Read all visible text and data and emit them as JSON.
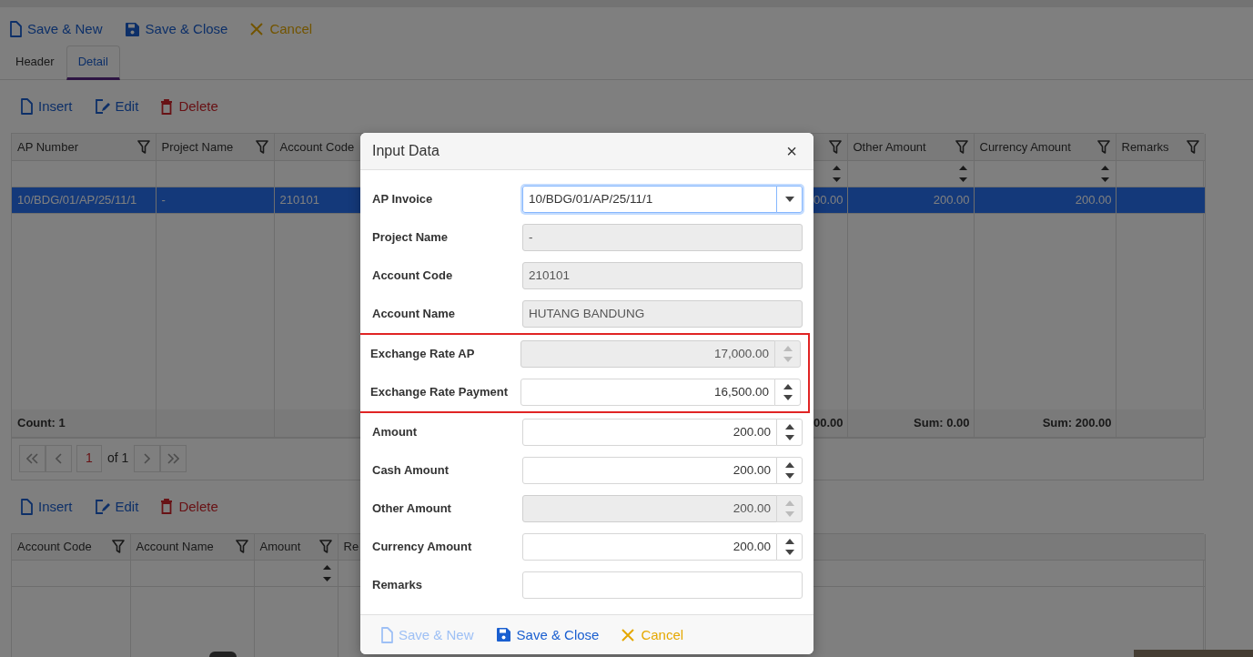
{
  "toolbar": [
    {
      "label": "Save & New",
      "kind": "new"
    },
    {
      "label": "Save & Close",
      "kind": "save"
    },
    {
      "label": "Cancel",
      "kind": "cancel"
    }
  ],
  "tabs": [
    {
      "label": "Header",
      "selected": false
    },
    {
      "label": "Detail",
      "selected": true
    }
  ],
  "detail_toolbar": [
    {
      "label": "Insert",
      "kind": "insert"
    },
    {
      "label": "Edit",
      "kind": "edit"
    },
    {
      "label": "Delete",
      "kind": "delete"
    }
  ],
  "detail_grid": {
    "columns": [
      {
        "label": "AP Number",
        "filter": true,
        "numeric": false
      },
      {
        "label": "Project Name",
        "filter": true,
        "numeric": false
      },
      {
        "label": "Account Code"
      },
      {
        "filter": true,
        "numeric": true
      },
      {
        "label": "Other Amount",
        "filter": true,
        "numeric": true
      },
      {
        "label": "Currency Amount",
        "filter": true,
        "numeric": true
      },
      {
        "label": "Remarks",
        "filter": true,
        "numeric": false
      }
    ],
    "rows": [
      {
        "selected": true,
        "cells": [
          "10/BDG/01/AP/25/11/1",
          "-",
          "210101",
          "00.00",
          "200.00",
          "200.00"
        ]
      }
    ],
    "footer": {
      "cells": [
        "Count: 1",
        null,
        null,
        "00.00",
        "Sum: 0.00",
        "Sum: 200.00"
      ]
    },
    "pager": {
      "page": "1",
      "total": "of 1"
    }
  },
  "account_toolbar": [
    {
      "label": "Insert",
      "kind": "insert"
    },
    {
      "label": "Edit",
      "kind": "edit"
    },
    {
      "label": "Delete",
      "kind": "delete"
    }
  ],
  "account_grid": {
    "columns": [
      {
        "label": "Account Code",
        "filter": true,
        "numeric": false
      },
      {
        "label": "Account Name",
        "filter": true,
        "numeric": false
      },
      {
        "label": "Amount",
        "filter": true,
        "numeric": true
      },
      {
        "label": "Re",
        "numeric": false
      }
    ]
  },
  "dialog": {
    "title": "Input Data",
    "close": "×",
    "fields": [
      {
        "label": "AP Invoice",
        "value": "10/BDG/01/AP/25/11/1",
        "kind": "combo",
        "disabled": false,
        "focused": true
      },
      {
        "label": "Project Name",
        "value": "-",
        "kind": "text",
        "disabled": true,
        "focused": false
      },
      {
        "label": "Account Code",
        "value": "210101",
        "kind": "text",
        "disabled": true,
        "focused": false
      },
      {
        "label": "Account Name",
        "value": "HUTANG BANDUNG",
        "kind": "text",
        "disabled": true,
        "focused": false
      },
      {
        "label": "Exchange Rate AP",
        "value": "17,000.00",
        "kind": "number",
        "disabled": true,
        "focused": false,
        "highlighted": true
      },
      {
        "label": "Exchange Rate Payment",
        "value": "16,500.00",
        "kind": "number",
        "disabled": false,
        "focused": false,
        "highlighted": true
      },
      {
        "label": "Amount",
        "value": "200.00",
        "kind": "number",
        "disabled": false,
        "focused": false
      },
      {
        "label": "Cash Amount",
        "value": "200.00",
        "kind": "number",
        "disabled": false,
        "focused": false
      },
      {
        "label": "Other Amount",
        "value": "200.00",
        "kind": "number",
        "disabled": true,
        "focused": false
      },
      {
        "label": "Currency Amount",
        "value": "200.00",
        "kind": "number",
        "disabled": false,
        "focused": false
      },
      {
        "label": "Remarks",
        "kind": "text",
        "disabled": false,
        "focused": false
      }
    ],
    "buttons": [
      {
        "label": "Save & New",
        "kind": "new",
        "disabled": true
      },
      {
        "label": "Save & Close",
        "kind": "save",
        "disabled": false
      },
      {
        "label": "Cancel",
        "kind": "cancel",
        "disabled": false
      }
    ]
  }
}
